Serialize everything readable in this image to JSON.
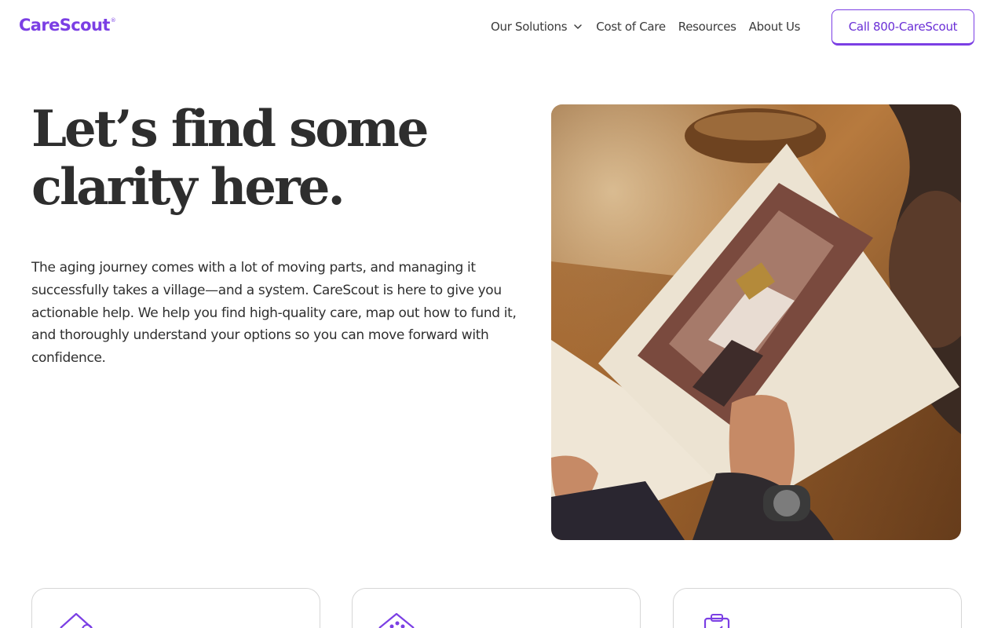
{
  "header": {
    "logo": "CareScout",
    "logo_mark": "®",
    "nav": [
      {
        "label": "Our Solutions",
        "has_dropdown": true
      },
      {
        "label": "Cost of Care"
      },
      {
        "label": "Resources"
      },
      {
        "label": "About Us"
      }
    ],
    "cta_label": "Call 800-CareScout"
  },
  "hero": {
    "title_line1": "Let’s find some",
    "title_line2": "clarity here.",
    "body": "The aging journey comes with a lot of moving parts, and managing it successfully takes a village—and a system. CareScout is here to give you actionable help. We help you find high-quality care, map out how to fund it, and thoroughly understand your options so you can move forward with confidence."
  },
  "cards": [
    {
      "icon": "house-search-icon"
    },
    {
      "icon": "house-people-icon"
    },
    {
      "icon": "clipboard-check-icon"
    }
  ],
  "colors": {
    "brand": "#7b3fe4",
    "text": "#2e2e2e"
  }
}
